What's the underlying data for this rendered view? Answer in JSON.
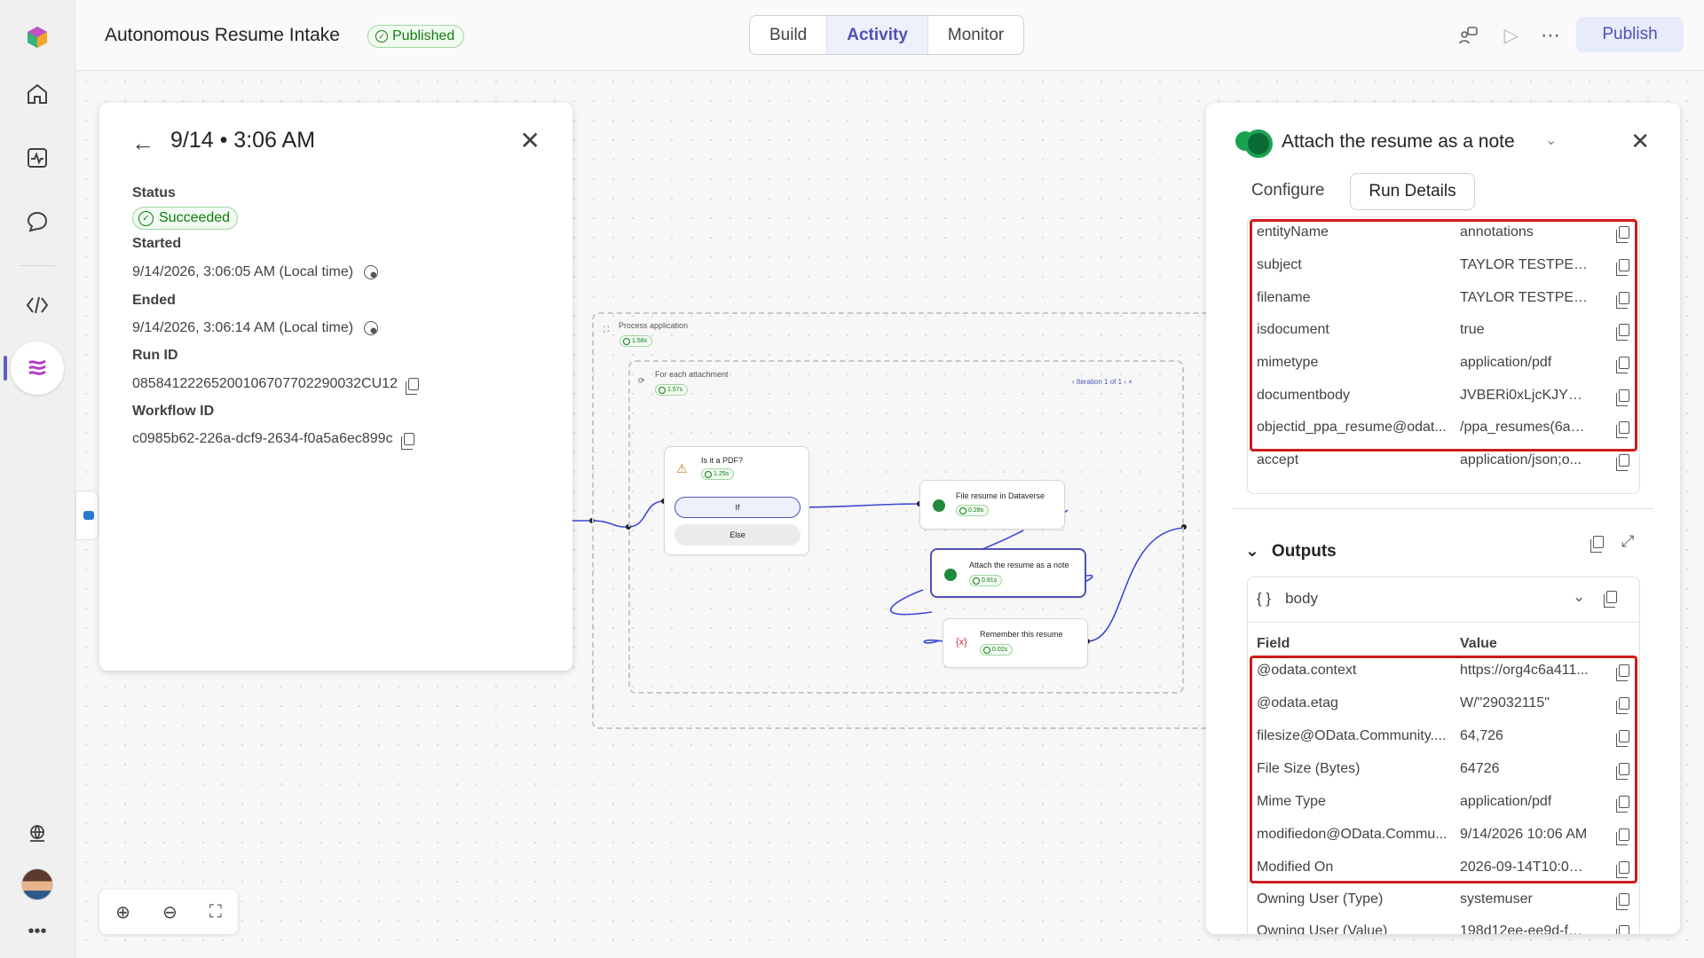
{
  "app": {
    "title": "Autonomous Resume Intake",
    "status_badge": "Published",
    "tabs": [
      {
        "label": "Build",
        "active": false
      },
      {
        "label": "Activity",
        "active": true
      },
      {
        "label": "Monitor",
        "active": false
      }
    ],
    "publish_label": "Publish"
  },
  "run": {
    "title": "9/14 • 3:06 AM",
    "status_label": "Status",
    "status_value": "Succeeded",
    "started_label": "Started",
    "started_value": "9/14/2026, 3:06:05 AM (Local time)",
    "ended_label": "Ended",
    "ended_value": "9/14/2026, 3:06:14 AM (Local time)",
    "run_id_label": "Run ID",
    "run_id_value": "08584122265200106707702290032CU12",
    "workflow_id_label": "Workflow ID",
    "workflow_id_value": "c0985b62-226a-dcf9-2634-f0a5a6ec899c"
  },
  "flow": {
    "process": {
      "label": "Process application",
      "duration": "1.58s"
    },
    "foreach": {
      "label": "For each attachment",
      "duration": "1.57s"
    },
    "iteration": {
      "label": "Iteration",
      "current": "1",
      "total": "of 1"
    },
    "condition": {
      "label": "Is it a PDF?",
      "duration": "1.25s",
      "if_label": "If",
      "else_label": "Else"
    },
    "file_node": {
      "label": "File resume in Dataverse",
      "duration": "0.28s"
    },
    "attach_node": {
      "label": "Attach the resume as a note",
      "duration": "0.91s"
    },
    "remember_node": {
      "label": "Remember this resume",
      "duration": "0.02s"
    }
  },
  "details": {
    "title": "Attach the resume as a note",
    "tab_configure": "Configure",
    "tab_run_details": "Run Details",
    "inputs": [
      {
        "key": "entityName",
        "value": "annotations"
      },
      {
        "key": "subject",
        "value": "TAYLOR TESTPERS..."
      },
      {
        "key": "filename",
        "value": "TAYLOR TESTPERS..."
      },
      {
        "key": "isdocument",
        "value": "true"
      },
      {
        "key": "mimetype",
        "value": "application/pdf"
      },
      {
        "key": "documentbody",
        "value": "JVBERi0xLjcKJYGB..."
      },
      {
        "key": "objectid_ppa_resume@odat...",
        "value": "/ppa_resumes(6a4..."
      },
      {
        "key": "accept",
        "value": "application/json;o..."
      }
    ],
    "outputs_title": "Outputs",
    "body_label": "body",
    "field_header": "Field",
    "value_header": "Value",
    "outputs": [
      {
        "key": "@odata.context",
        "value": "https://org4c6a411..."
      },
      {
        "key": "@odata.etag",
        "value": "W/\"29032115\""
      },
      {
        "key": "filesize@OData.Community....",
        "value": "64,726"
      },
      {
        "key": "File Size (Bytes)",
        "value": "64726"
      },
      {
        "key": "Mime Type",
        "value": "application/pdf"
      },
      {
        "key": "modifiedon@OData.Commu...",
        "value": "9/14/2026 10:06 AM"
      },
      {
        "key": "Modified On",
        "value": "2026-09-14T10:06:..."
      },
      {
        "key": "Owning User (Type)",
        "value": "systemuser"
      },
      {
        "key": "Owning User (Value)",
        "value": "198d12ee-ee9d-f11..."
      }
    ]
  },
  "colors": {
    "accent": "#4f52b2",
    "success": "#107c10",
    "highlight_box": "#d11a1a",
    "connector": "#3b47d6"
  }
}
